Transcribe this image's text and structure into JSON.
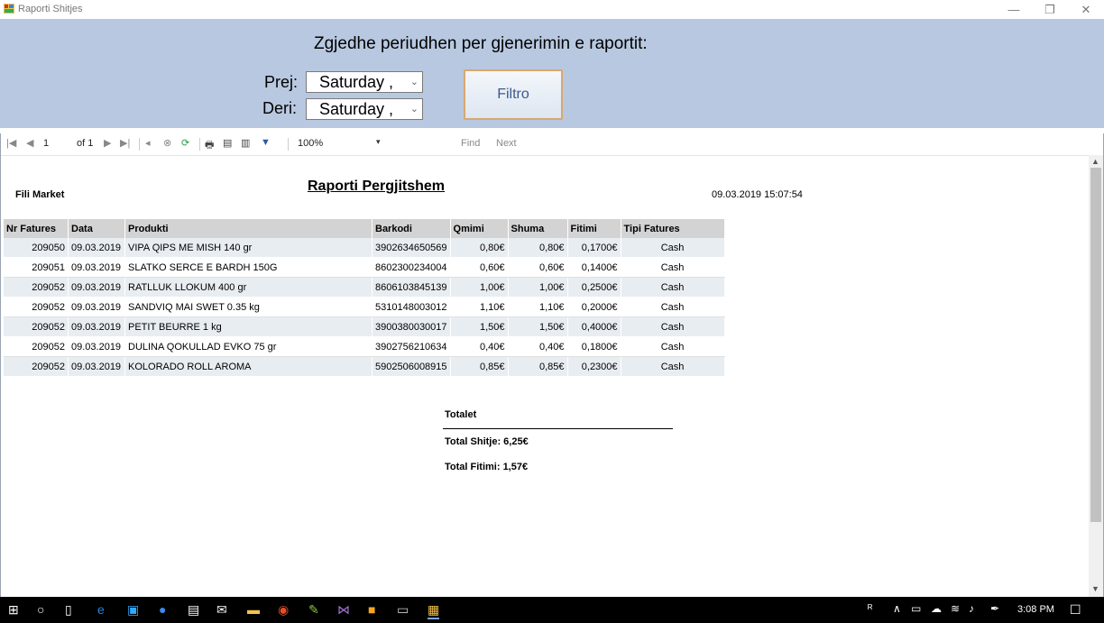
{
  "window": {
    "title": "Raporti Shitjes",
    "minimize": "—",
    "restore": "❐",
    "close": "✕"
  },
  "filter": {
    "heading": "Zgjedhe periudhen per gjenerimin e raportit:",
    "from_label": "Prej:",
    "to_label": "Deri:",
    "from_value": "Saturday  ,",
    "to_value": "Saturday  ,",
    "button": "Filtro"
  },
  "toolbar": {
    "page": "1",
    "of": "of 1",
    "zoom": "100%",
    "find": "Find",
    "next": "Next"
  },
  "report": {
    "title": "Raporti Pergjitshem",
    "company": "Fili Market",
    "timestamp": "09.03.2019 15:07:54",
    "columns": [
      "Nr Fatures",
      "Data",
      "Produkti",
      "Barkodi",
      "Qmimi",
      "Shuma",
      "Fitimi",
      "Tipi Fatures"
    ],
    "rows": [
      [
        "209050",
        "09.03.2019",
        "VIPA QIPS ME MISH 140 gr",
        "3902634650569",
        "0,80€",
        "0,80€",
        "0,1700€",
        "Cash"
      ],
      [
        "209051",
        "09.03.2019",
        "SLATKO SERCE E BARDH 150G",
        "8602300234004",
        "0,60€",
        "0,60€",
        "0,1400€",
        "Cash"
      ],
      [
        "209052",
        "09.03.2019",
        "RATLLUK   LLOKUM  400 gr",
        "8606103845139",
        "1,00€",
        "1,00€",
        "0,2500€",
        "Cash"
      ],
      [
        "209052",
        "09.03.2019",
        "SANDVIQ MAI SWET   0.35 kg",
        "5310148003012",
        "1,10€",
        "1,10€",
        "0,2000€",
        "Cash"
      ],
      [
        "209052",
        "09.03.2019",
        "PETIT BEURRE   1 kg",
        "3900380030017",
        "1,50€",
        "1,50€",
        "0,4000€",
        "Cash"
      ],
      [
        "209052",
        "09.03.2019",
        "DULINA QOKULLAD EVKO 75 gr",
        "3902756210634",
        "0,40€",
        "0,40€",
        "0,1800€",
        "Cash"
      ],
      [
        "209052",
        "09.03.2019",
        "KOLORADO ROLL AROMA",
        "5902506008915",
        "0,85€",
        "0,85€",
        "0,2300€",
        "Cash"
      ]
    ],
    "totals_title": "Totalet",
    "total_sales": "Total Shitje:  6,25€",
    "total_profit": "Total Fitimi:  1,57€"
  },
  "taskbar": {
    "clock": "3:08 PM"
  }
}
